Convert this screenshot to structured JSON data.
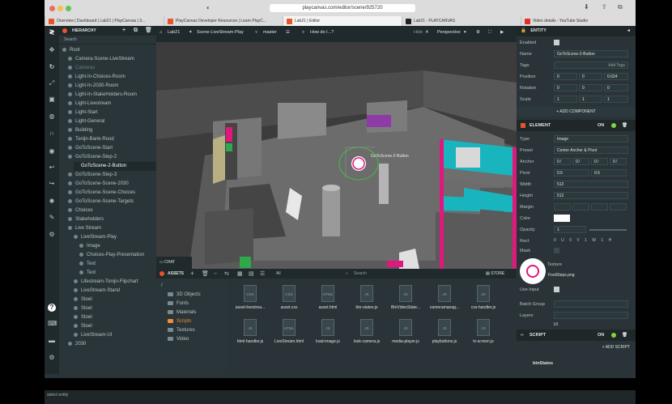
{
  "browser": {
    "url": "playcanvas.com/editor/scene/925720",
    "tabs": [
      "Overview | Dashboard | Lab21 | PlayCanvas | 3...",
      "PlayCanvas Developer Resources | Learn PlayC...",
      "Lab21 | Editor",
      "Lab21 - PLAYCANVAS",
      "Video details - YouTube Studio"
    ]
  },
  "hierarchy": {
    "title": "HIERARCHY",
    "search_placeholder": "Search",
    "items": [
      {
        "label": "Root"
      },
      {
        "label": "Camera-Scene-LiveStream"
      },
      {
        "label": "Cameras"
      },
      {
        "label": "Light-In-Choices-Room"
      },
      {
        "label": "Light-In-2030-Room"
      },
      {
        "label": "Light-In-StakeHolders-Room"
      },
      {
        "label": "Light-Livestream"
      },
      {
        "label": "Light-Start"
      },
      {
        "label": "Light-General"
      },
      {
        "label": "Building"
      },
      {
        "label": "Tonijn-Bank-Rood"
      },
      {
        "label": "GoToScene-Start"
      },
      {
        "label": "GoToScene-Step-2"
      },
      {
        "label": "GoToScene-2-Button"
      },
      {
        "label": "GoToScene-Step-3"
      },
      {
        "label": "GoToScene-Scene-2030"
      },
      {
        "label": "GoToScene-Scene-Choices"
      },
      {
        "label": "GoToScene-Scene-Targets"
      },
      {
        "label": "Choices"
      },
      {
        "label": "Stakeholders"
      },
      {
        "label": "Live Stream"
      },
      {
        "label": "LiveStream-Play"
      },
      {
        "label": "Image"
      },
      {
        "label": "Choices-Play-Presentation"
      },
      {
        "label": "Text"
      },
      {
        "label": "Text"
      },
      {
        "label": "Lifestream-Tonijn-Flipchart"
      },
      {
        "label": "LiveStream-Stand"
      },
      {
        "label": "Stoel"
      },
      {
        "label": "Stoel"
      },
      {
        "label": "Stoel"
      },
      {
        "label": "Stoel"
      },
      {
        "label": "LiveStream-UI"
      },
      {
        "label": "2030"
      }
    ]
  },
  "viewport": {
    "project": "Lab21",
    "scene": "Scene-LiveStream-Play",
    "branch": "master",
    "howdo": "How do I...?",
    "hide": "Hide",
    "camera": "Perspective",
    "selected_label": "GoToScene-2-Button",
    "chat": "CHAT"
  },
  "assets": {
    "title": "ASSETS",
    "filter": "All",
    "search_placeholder": "Search",
    "store": "STORE",
    "folders": [
      "/",
      "3D Objects",
      "Fonts",
      "Materials",
      "Scripts",
      "Textures",
      "Video"
    ],
    "files": [
      {
        "type": "CSS",
        "name": "asset-livestrea..."
      },
      {
        "type": "CSS",
        "name": "asset.css"
      },
      {
        "type": "HTML",
        "name": "asset.html"
      },
      {
        "type": "JS",
        "name": "btn-states.js"
      },
      {
        "type": "JS",
        "name": "BtnVideoState..."
      },
      {
        "type": "JS",
        "name": "cameramanag..."
      },
      {
        "type": "JS",
        "name": "css-handler.js"
      },
      {
        "type": "JS",
        "name": "html-handler.js"
      },
      {
        "type": "HTML",
        "name": "LiveStream.html"
      },
      {
        "type": "JS",
        "name": "load-image.js"
      },
      {
        "type": "JS",
        "name": "look-camera.js"
      },
      {
        "type": "JS",
        "name": "media-player.js"
      },
      {
        "type": "JS",
        "name": "playbuttons.js"
      },
      {
        "type": "JS",
        "name": "tv-screen.js"
      }
    ]
  },
  "entity": {
    "title": "ENTITY",
    "enabled_label": "Enabled",
    "name_label": "Name",
    "name_value": "GoToScene-2-Button",
    "tags_label": "Tags",
    "tags_placeholder": "Add Tags",
    "position_label": "Position",
    "position": [
      "0",
      "0",
      "0.024"
    ],
    "rotation_label": "Rotation",
    "rotation": [
      "0",
      "0",
      "0"
    ],
    "scale_label": "Scale",
    "scale": [
      "1",
      "1",
      "1"
    ],
    "add_component": "+ ADD COMPONENT",
    "element_title": "ELEMENT",
    "on": "ON",
    "type_label": "Type",
    "type_value": "Image",
    "preset_label": "Preset",
    "preset_value": "Center Anchor & Pivot",
    "anchor_label": "Anchor",
    "anchor": [
      "0.!",
      "0.!",
      "0.!",
      "0.!"
    ],
    "pivot_label": "Pivot",
    "pivot": [
      "0.5",
      "0.5"
    ],
    "width_label": "Width",
    "width_value": "512",
    "height_label": "Height",
    "height_value": "512",
    "margin_label": "Margin",
    "color_label": "Color",
    "opacity_label": "Opacity",
    "opacity_value": "1",
    "rect_label": "Rect",
    "rect": [
      "0",
      "U",
      "0",
      "V",
      "1",
      "W",
      "1",
      "H"
    ],
    "mask_label": "Mask",
    "texture_label": "Texture",
    "texture_file": "FootSteps.png",
    "useinput_label": "Use Input",
    "batchgroup_label": "Batch Group",
    "layers_label": "Layers",
    "layers_value": "UI",
    "script_title": "SCRIPT",
    "add_script": "+ ADD SCRIPT",
    "btnstates": "btnStates"
  },
  "status_text": "select entity"
}
